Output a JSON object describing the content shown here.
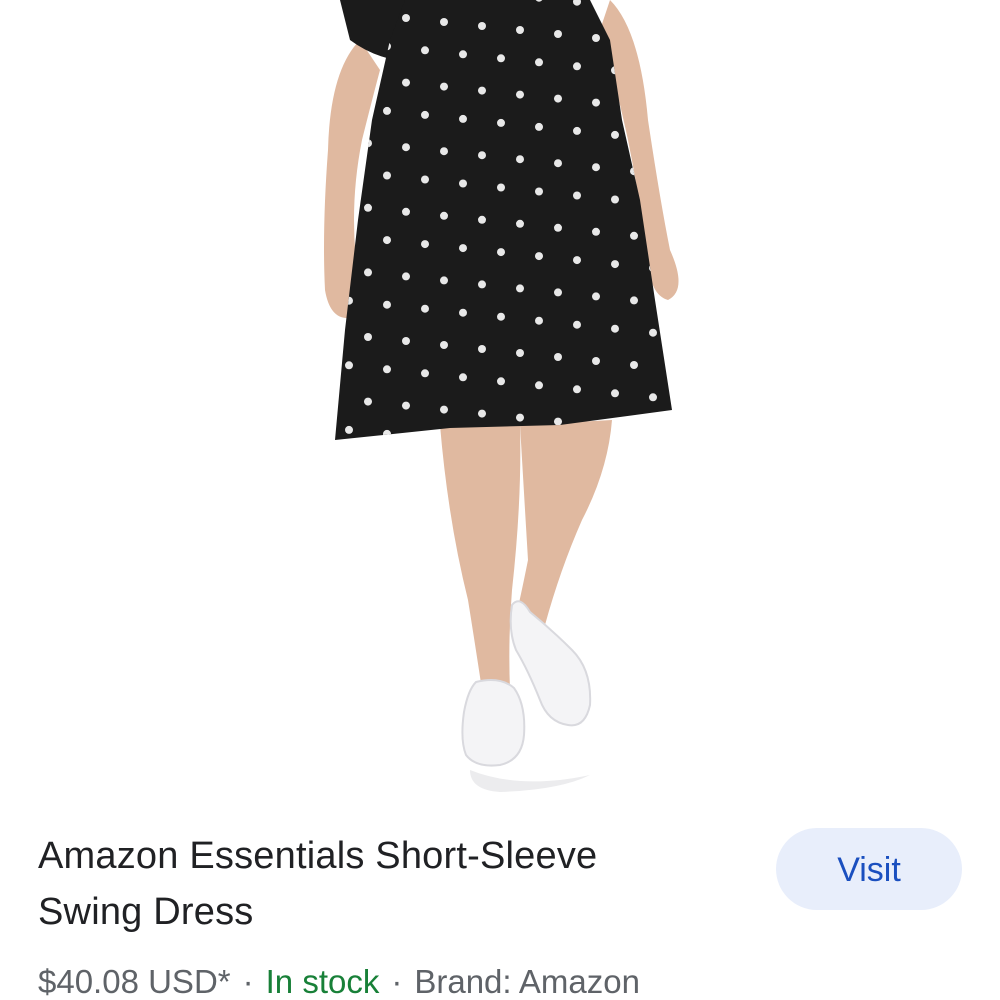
{
  "product": {
    "image_alt": "Black polka dot swing dress with white sneakers",
    "title_line1": "Amazon Essentials Short-Sleeve",
    "title_line2": "Swing Dress",
    "price": "$40.08 USD*",
    "separator": "·",
    "stock_status": "In stock",
    "brand": "Brand: Amazon"
  },
  "actions": {
    "visit_label": "Visit"
  },
  "colors": {
    "text_primary": "#202124",
    "text_secondary": "#5f6368",
    "in_stock": "#188038",
    "visit_bg": "#e8eefb",
    "visit_text": "#1a4fbf",
    "dress": "#1b1b1b",
    "dots": "#e8e8e8",
    "skin": "#e0b9a0"
  }
}
